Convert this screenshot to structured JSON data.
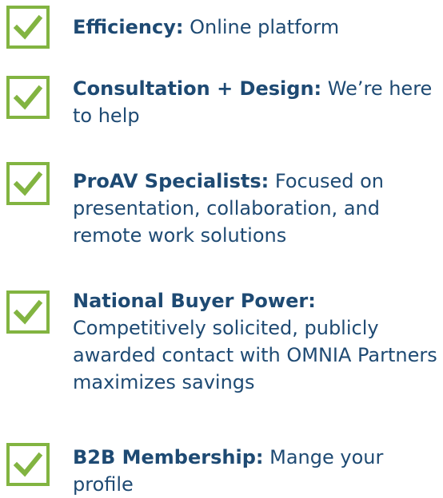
{
  "colors": {
    "text": "#1e4a73",
    "check": "#82b441"
  },
  "benefits": [
    {
      "icon": "checkbox-checked-icon",
      "label": "Efficiency:",
      "desc": "Online platform"
    },
    {
      "icon": "checkbox-checked-icon",
      "label": "Consultation + Design:",
      "desc": "We’re here to help"
    },
    {
      "icon": "checkbox-checked-icon",
      "label": "ProAV Specialists:",
      "desc": "Focused on presentation, collaboration, and remote work solutions"
    },
    {
      "icon": "checkbox-checked-icon",
      "label": "National Buyer Power:",
      "desc": "Competitively solicited, publicly awarded contact with OMNIA Partners maximizes savings"
    },
    {
      "icon": "checkbox-checked-icon",
      "label": "B2B Membership:",
      "desc": "Mange your profile"
    }
  ]
}
